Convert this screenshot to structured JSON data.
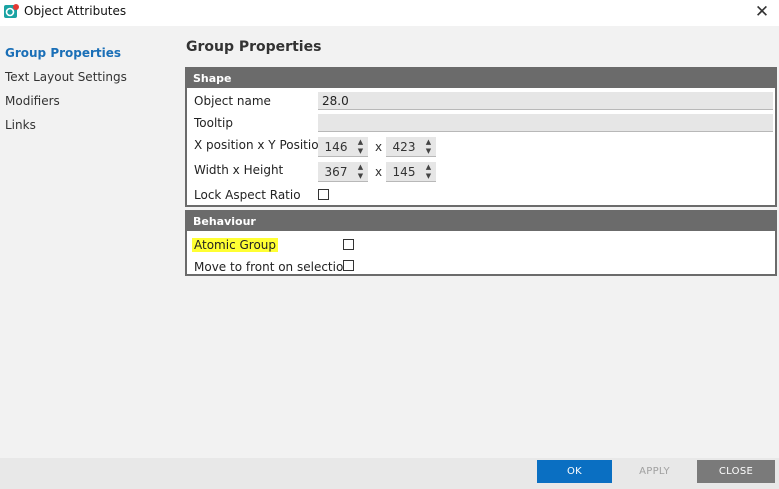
{
  "window": {
    "title": "Object Attributes",
    "app_icon": "app-icon",
    "close_icon": "close-icon",
    "close_glyph": "✕"
  },
  "sidebar": {
    "items": [
      {
        "label": "Group Properties",
        "active": true
      },
      {
        "label": "Text Layout Settings",
        "active": false
      },
      {
        "label": "Modifiers",
        "active": false
      },
      {
        "label": "Links",
        "active": false
      }
    ]
  },
  "main": {
    "title": "Group Properties",
    "shape": {
      "header": "Shape",
      "object_name_label": "Object name",
      "object_name_value": "28.0",
      "tooltip_label": "Tooltip",
      "tooltip_value": "",
      "position_label": "X position x Y Position",
      "x_position": "146",
      "y_position": "423",
      "size_label": "Width x Height",
      "width": "367",
      "height": "145",
      "times": "x",
      "lock_aspect_label": "Lock Aspect Ratio",
      "lock_aspect_checked": false
    },
    "behaviour": {
      "header": "Behaviour",
      "atomic_group_label": "Atomic Group",
      "atomic_group_checked": false,
      "move_front_label": "Move to front on selection",
      "move_front_checked": false
    }
  },
  "footer": {
    "ok_label": "OK",
    "apply_label": "APPLY",
    "close_label": "CLOSE"
  },
  "colors": {
    "accent": "#1a6fb7",
    "ok_button": "#0a6fc2",
    "group_header": "#6b6b6b",
    "highlight": "#ffff33",
    "close_button": "#7a7a7a"
  }
}
